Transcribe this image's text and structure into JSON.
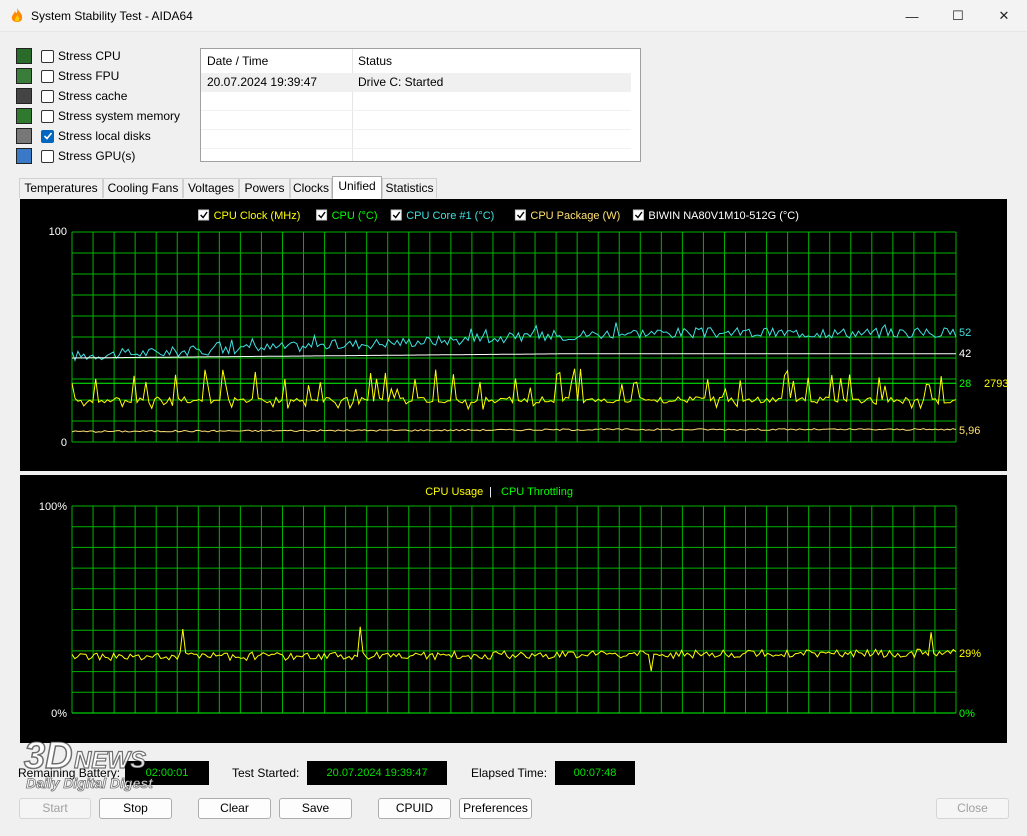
{
  "window": {
    "title": "System Stability Test - AIDA64",
    "minimize_glyph": "—",
    "maximize_glyph": "☐",
    "close_glyph": "✕"
  },
  "stress_options": [
    {
      "label": "Stress CPU",
      "checked": false,
      "icon": "cpu-icon"
    },
    {
      "label": "Stress FPU",
      "checked": false,
      "icon": "fpu-icon"
    },
    {
      "label": "Stress cache",
      "checked": false,
      "icon": "cache-icon"
    },
    {
      "label": "Stress system memory",
      "checked": false,
      "icon": "memory-icon"
    },
    {
      "label": "Stress local disks",
      "checked": true,
      "icon": "disk-icon"
    },
    {
      "label": "Stress GPU(s)",
      "checked": false,
      "icon": "gpu-icon"
    }
  ],
  "log": {
    "col_datetime": "Date / Time",
    "col_status": "Status",
    "rows": [
      {
        "datetime": "20.07.2024 19:39:47",
        "status": "Drive C: Started"
      }
    ]
  },
  "tabs": [
    "Temperatures",
    "Cooling Fans",
    "Voltages",
    "Powers",
    "Clocks",
    "Unified",
    "Statistics"
  ],
  "active_tab": "Unified",
  "colors": {
    "grid": "#00b400",
    "cpu_clock": "#ffff00",
    "cpu_temp": "#00ff00",
    "cpu_core1": "#40e0e0",
    "cpu_package": "#ffe070",
    "ssd_temp": "#ffffff",
    "cpu_usage": "#ffff00",
    "cpu_throttling": "#00ff00"
  },
  "chart_data": [
    {
      "type": "line",
      "legend": [
        {
          "name": "CPU Clock (MHz)",
          "checked": true,
          "color": "#ffff00"
        },
        {
          "name": "CPU (°C)",
          "checked": true,
          "color": "#00ff00"
        },
        {
          "name": "CPU Core #1 (°C)",
          "checked": true,
          "color": "#40e0e0"
        },
        {
          "name": "CPU Package (W)",
          "checked": true,
          "color": "#ffe070"
        },
        {
          "name": "BIWIN NA80V1M10-512G (°C)",
          "checked": true,
          "color": "#ffffff"
        }
      ],
      "ylim": [
        0,
        100
      ],
      "y_max_label": "100",
      "y_min_label": "0",
      "current_values": [
        {
          "series": "CPU Core #1 (°C)",
          "text": "52",
          "value": 52,
          "color": "#40e0e0"
        },
        {
          "series": "BIWIN NA80V1M10-512G (°C)",
          "text": "42",
          "value": 42,
          "color": "#ffffff"
        },
        {
          "series": "CPU (°C)",
          "text": "28",
          "value": 28,
          "color": "#00ff00"
        },
        {
          "series": "CPU Clock (MHz)",
          "text": "2793",
          "value": 2793,
          "color": "#ffff00"
        },
        {
          "series": "CPU Package (W)",
          "text": "5,96",
          "value": 5.96,
          "color": "#ffe070"
        }
      ],
      "series": [
        {
          "name": "CPU Core #1 (°C)",
          "start": 41,
          "end": 52,
          "noise": 2.5
        },
        {
          "name": "BIWIN NA80V1M10-512G (°C)",
          "start": 40,
          "end": 42,
          "noise": 0
        },
        {
          "name": "CPU (°C)",
          "start": 28,
          "end": 28,
          "noise": 0
        },
        {
          "name": "CPU Clock (MHz)",
          "start": 2400,
          "end": 2793,
          "noise": 1
        },
        {
          "name": "CPU Package (W)",
          "start": 5,
          "end": 5.96,
          "noise": 0.4
        }
      ],
      "grid": true
    },
    {
      "type": "line",
      "legend": [
        {
          "name": "CPU Usage",
          "color": "#ffff00"
        },
        {
          "name": "CPU Throttling",
          "color": "#00ff00"
        }
      ],
      "legend_separator": "|",
      "ylim": [
        0,
        100
      ],
      "y_max_label": "100%",
      "y_min_label": "0%",
      "current_values": [
        {
          "series": "CPU Usage",
          "text": "29%",
          "value": 29,
          "color": "#ffff00"
        },
        {
          "series": "CPU Throttling",
          "text": "0%",
          "value": 0,
          "color": "#00ff00"
        }
      ],
      "series": [
        {
          "name": "CPU Usage",
          "start": 27,
          "end": 29,
          "noise": 2
        },
        {
          "name": "CPU Throttling",
          "start": 0,
          "end": 0,
          "noise": 0
        }
      ],
      "grid": true
    }
  ],
  "status": {
    "remaining_battery_label": "Remaining Battery:",
    "remaining_battery_value": "02:00:01",
    "test_started_label": "Test Started:",
    "test_started_value": "20.07.2024 19:39:47",
    "elapsed_label": "Elapsed Time:",
    "elapsed_value": "00:07:48"
  },
  "buttons": {
    "start": "Start",
    "stop": "Stop",
    "clear": "Clear",
    "save": "Save",
    "cpuid": "CPUID",
    "preferences": "Preferences",
    "close": "Close"
  },
  "watermark": {
    "brand": "3DNews",
    "tagline": "Daily Digital Digest"
  }
}
